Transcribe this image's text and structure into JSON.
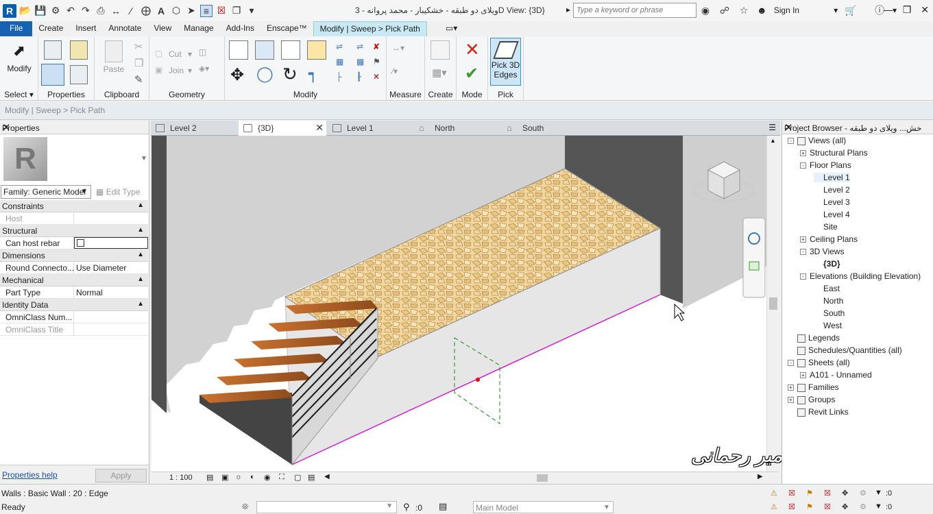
{
  "titlebar": {
    "title": "3 - ویلای دو طبقه - خشکیبار - محمد پروانهD View: {3D}",
    "search_placeholder": "Type a keyword or phrase",
    "sign_in": "Sign In",
    "icons": [
      "revit-logo",
      "open-icon",
      "save-icon",
      "sync-icon",
      "undo-icon",
      "redo-icon",
      "print-icon",
      "measure-icon",
      "text-icon",
      "default-3d-icon",
      "thin-lines-icon",
      "close-hidden-icon",
      "switch-windows-icon",
      "binoculars-icon",
      "star-icon",
      "user-icon",
      "cart-icon",
      "help-icon"
    ]
  },
  "ribbon_tabs": [
    "File",
    "Create",
    "Insert",
    "Annotate",
    "View",
    "Manage",
    "Add-Ins",
    "Enscape™",
    "Modify | Sweep > Pick Path"
  ],
  "ribbon": {
    "modify": "Modify",
    "select": "Select",
    "properties": "Properties",
    "paste": "Paste",
    "clipboard": "Clipboard",
    "cut": "Cut",
    "join": "Join",
    "geometry": "Geometry",
    "modify_panel": "Modify",
    "measure": "Measure",
    "create": "Create",
    "mode": "Mode",
    "pick_3d_edges": "Pick 3D Edges",
    "pick": "Pick"
  },
  "options_bar": "Modify | Sweep > Pick Path",
  "properties": {
    "header": "Properties",
    "family": "Family: Generic Model",
    "edit_type": "Edit Type",
    "categories": [
      {
        "name": "Constraints",
        "rows": [
          {
            "k": "Host",
            "v": "",
            "disabled": true
          }
        ]
      },
      {
        "name": "Structural",
        "rows": [
          {
            "k": "Can host rebar",
            "v": "",
            "checkbox": true
          }
        ]
      },
      {
        "name": "Dimensions",
        "rows": [
          {
            "k": "Round Connecto...",
            "v": "Use Diameter"
          }
        ]
      },
      {
        "name": "Mechanical",
        "rows": [
          {
            "k": "Part Type",
            "v": "Normal"
          }
        ]
      },
      {
        "name": "Identity Data",
        "rows": [
          {
            "k": "OmniClass Num...",
            "v": ""
          },
          {
            "k": "OmniClass Title",
            "v": "",
            "disabled": true
          }
        ]
      }
    ],
    "help": "Properties help",
    "apply": "Apply"
  },
  "view_tabs": [
    "Level 2",
    "{3D}",
    "Level 1",
    "North",
    "South"
  ],
  "view_scale": "1 : 100",
  "watermark": "مدرس : مهندس امیر رحمانی",
  "browser": {
    "header": "Project Browser - خش... ویلای دو طبقه -",
    "nodes": [
      {
        "label": "Views (all)",
        "level": 0,
        "exp": "-"
      },
      {
        "label": "Structural Plans",
        "level": 1,
        "exp": "+"
      },
      {
        "label": "Floor Plans",
        "level": 1,
        "exp": "-"
      },
      {
        "label": "Level 1",
        "level": 2,
        "sel": true
      },
      {
        "label": "Level 2",
        "level": 2
      },
      {
        "label": "Level 3",
        "level": 2
      },
      {
        "label": "Level 4",
        "level": 2
      },
      {
        "label": "Site",
        "level": 2
      },
      {
        "label": "Ceiling Plans",
        "level": 1,
        "exp": "+"
      },
      {
        "label": "3D Views",
        "level": 1,
        "exp": "-"
      },
      {
        "label": "{3D}",
        "level": 2,
        "bold": true
      },
      {
        "label": "Elevations (Building Elevation)",
        "level": 1,
        "exp": "-"
      },
      {
        "label": "East",
        "level": 2
      },
      {
        "label": "North",
        "level": 2
      },
      {
        "label": "South",
        "level": 2
      },
      {
        "label": "West",
        "level": 2
      },
      {
        "label": "Legends",
        "level": 0
      },
      {
        "label": "Schedules/Quantities (all)",
        "level": 0
      },
      {
        "label": "Sheets (all)",
        "level": 0,
        "exp": "-"
      },
      {
        "label": "A101 - Unnamed",
        "level": 1,
        "exp": "+"
      },
      {
        "label": "Families",
        "level": 0,
        "exp": "+"
      },
      {
        "label": "Groups",
        "level": 0,
        "exp": "+"
      },
      {
        "label": "Revit Links",
        "level": 0
      }
    ]
  },
  "status": {
    "line1": "Walls : Basic Wall : 20 : Edge",
    "line2": "Ready",
    "zero": ":0",
    "model": "Main Model",
    "filter1": ":0",
    "filter2": ":0"
  }
}
